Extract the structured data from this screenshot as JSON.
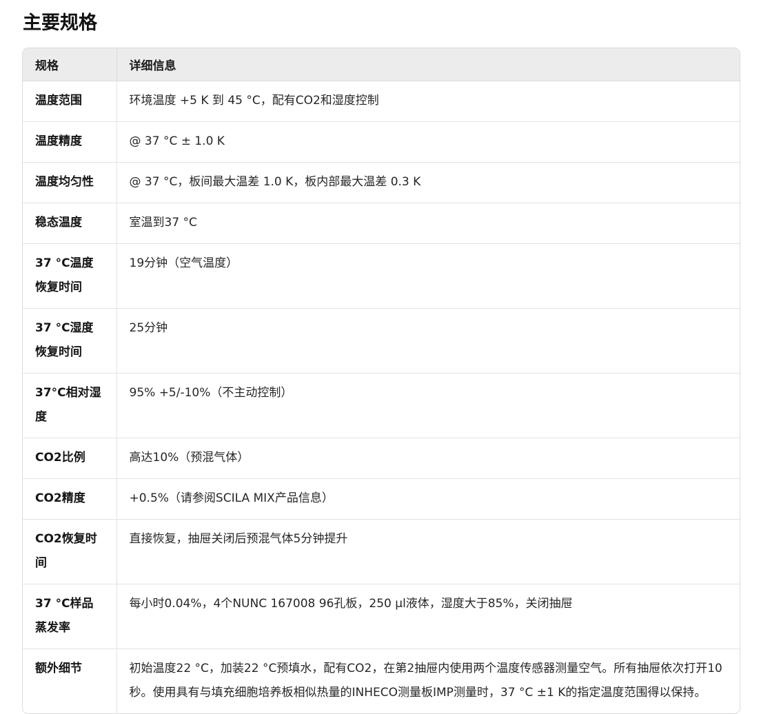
{
  "title": "主要规格",
  "table": {
    "headers": [
      "规格",
      "详细信息"
    ],
    "rows": [
      {
        "k": "温度范围",
        "v": "环境温度 +5 K 到 45 °C，配有CO2和湿度控制"
      },
      {
        "k": "温度精度",
        "v": "@ 37 °C ± 1.0 K"
      },
      {
        "k": "温度均匀性",
        "v": "@ 37 °C，板间最大温差 1.0 K，板内部最大温差 0.3 K"
      },
      {
        "k": "稳态温度",
        "v": "室温到37 °C"
      },
      {
        "k": "37 °C温度恢复时间",
        "v": "19分钟（空气温度）"
      },
      {
        "k": "37 °C湿度恢复时间",
        "v": "25分钟"
      },
      {
        "k": "37°C相对湿度",
        "v": "95% +5/-10%（不主动控制）"
      },
      {
        "k": "CO2比例",
        "v": "高达10%（预混气体）"
      },
      {
        "k": "CO2精度",
        "v": "+0.5%（请参阅SCILA MIX产品信息）"
      },
      {
        "k": "CO2恢复时间",
        "v": "直接恢复，抽屉关闭后预混气体5分钟提升"
      },
      {
        "k": "37 °C样品蒸发率",
        "v": "每小时0.04%，4个NUNC 167008 96孔板，250 µl液体，湿度大于85%，关闭抽屉"
      },
      {
        "k": "额外细节",
        "v": "初始温度22 °C，加装22 °C预填水，配有CO2，在第2抽屉内使用两个温度传感器测量空气。所有抽屉依次打开10秒。使用具有与填充细胞培养板相似热量的INHECO测量板IMP测量时，37 °C ±1 K的指定温度范围得以保持。"
      }
    ]
  }
}
